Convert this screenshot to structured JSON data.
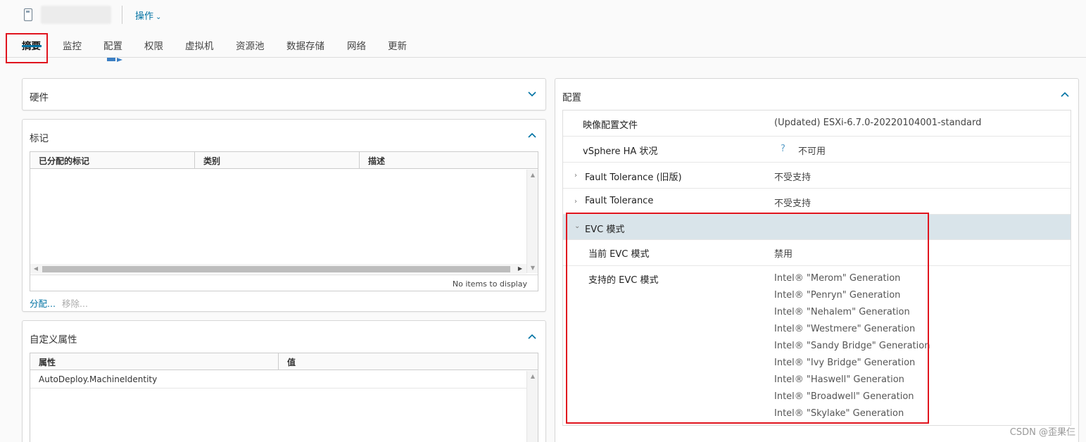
{
  "header": {
    "actions_label": "操作"
  },
  "tabs": [
    {
      "label": "摘要",
      "active": true
    },
    {
      "label": "监控"
    },
    {
      "label": "配置"
    },
    {
      "label": "权限"
    },
    {
      "label": "虚拟机"
    },
    {
      "label": "资源池"
    },
    {
      "label": "数据存储"
    },
    {
      "label": "网络"
    },
    {
      "label": "更新"
    }
  ],
  "hardware_panel": {
    "title": "硬件"
  },
  "tags_panel": {
    "title": "标记",
    "columns": [
      "已分配的标记",
      "类别",
      "描述"
    ],
    "empty_text": "No items to display",
    "assign_label": "分配...",
    "remove_label": "移除..."
  },
  "custom_attrs_panel": {
    "title": "自定义属性",
    "columns": [
      "属性",
      "值"
    ],
    "rows": [
      {
        "attribute": "AutoDeploy.MachineIdentity",
        "value": ""
      }
    ]
  },
  "config_panel": {
    "title": "配置",
    "rows": [
      {
        "label": "映像配置文件",
        "value": "(Updated) ESXi-6.7.0-20220104001-standard"
      },
      {
        "label": "vSphere HA 状况",
        "value": "不可用",
        "help": "?"
      },
      {
        "label": "Fault Tolerance (旧版)",
        "value": "不受支持"
      },
      {
        "label": "Fault Tolerance",
        "value": "不受支持"
      }
    ],
    "evc": {
      "label": "EVC 模式",
      "current_label": "当前 EVC 模式",
      "current_value": "禁用",
      "supported_label": "支持的 EVC 模式",
      "supported_modes": [
        "Intel® \"Merom\" Generation",
        "Intel® \"Penryn\" Generation",
        "Intel® \"Nehalem\" Generation",
        "Intel® \"Westmere\" Generation",
        "Intel® \"Sandy Bridge\" Generation",
        "Intel® \"Ivy Bridge\" Generation",
        "Intel® \"Haswell\" Generation",
        "Intel® \"Broadwell\" Generation",
        "Intel® \"Skylake\" Generation"
      ]
    }
  },
  "watermark": "CSDN @歪果仨",
  "colors": {
    "accent": "#0072a3",
    "highlight": "#e0141e",
    "selected_row": "#d9e4ea"
  }
}
